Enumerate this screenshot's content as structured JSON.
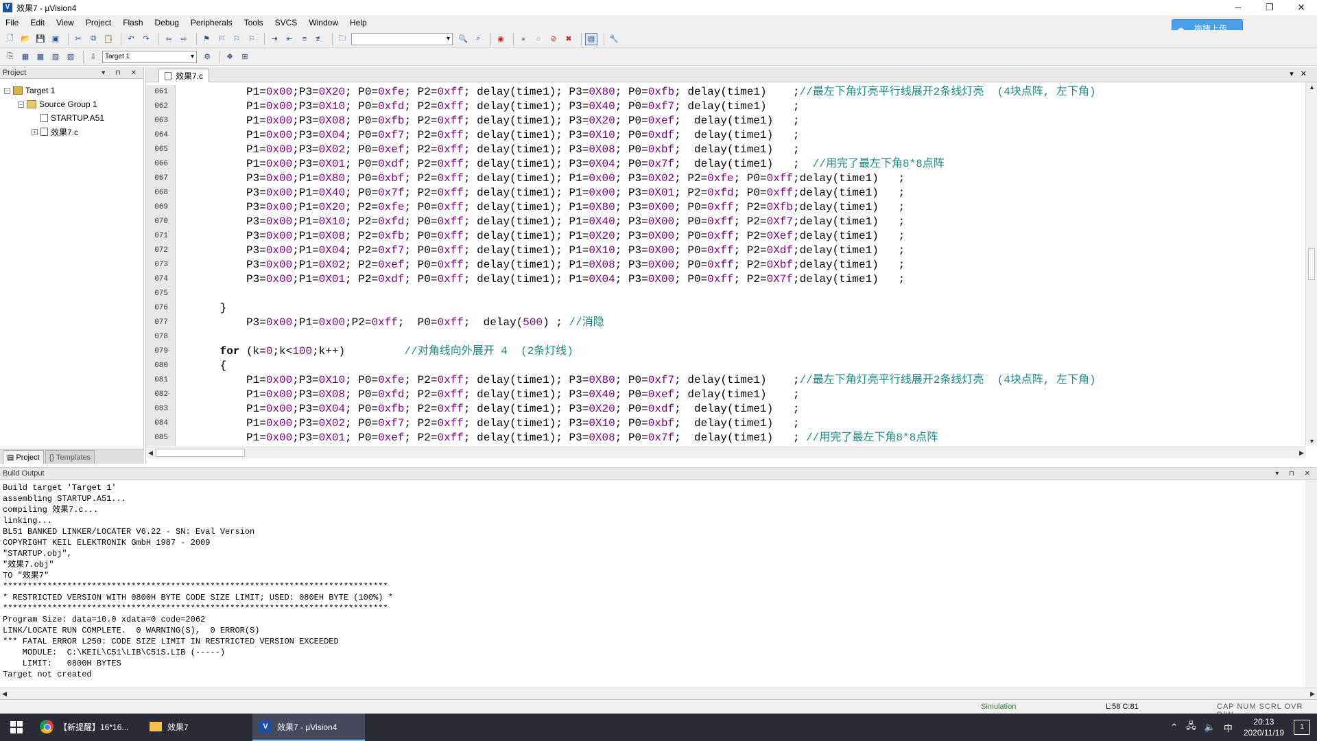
{
  "window": {
    "title": "效果7 - µVision4",
    "minimize": "─",
    "maximize": "❐",
    "close": "✕"
  },
  "menu": [
    "File",
    "Edit",
    "View",
    "Project",
    "Flash",
    "Debug",
    "Peripherals",
    "Tools",
    "SVCS",
    "Window",
    "Help"
  ],
  "toolbar": {
    "target_select": "Target 1",
    "upload_button": "拖拽上传"
  },
  "project_panel": {
    "title": "Project",
    "controls": "▾ ⊓ ✕",
    "tree": [
      {
        "label": "Target 1",
        "level": 0,
        "expander": "−",
        "icon": "target"
      },
      {
        "label": "Source Group 1",
        "level": 1,
        "expander": "−",
        "icon": "folder"
      },
      {
        "label": "STARTUP.A51",
        "level": 2,
        "expander": "",
        "icon": "file"
      },
      {
        "label": "效果7.c",
        "level": 2,
        "expander": "+",
        "icon": "file"
      }
    ],
    "tabs": [
      "Project",
      "Templates"
    ]
  },
  "editor": {
    "tab_label": "效果7.c",
    "line_numbers": [
      "061",
      "062",
      "063",
      "064",
      "065",
      "066",
      "067",
      "068",
      "069",
      "070",
      "071",
      "072",
      "073",
      "074",
      "075",
      "076",
      "077",
      "078",
      "079",
      "080",
      "081",
      "082",
      "083",
      "084",
      "085"
    ],
    "lines": [
      "          P1=0x00;P3=0X20; P0=0xfe; P2=0xff; delay(time1); P3=0X80; P0=0xfb; delay(time1)    ;//最左下角灯亮平行线展开2条线灯亮  (4块点阵, 左下角)",
      "          P1=0x00;P3=0X10; P0=0xfd; P2=0xff; delay(time1); P3=0X40; P0=0xf7; delay(time1)    ;",
      "          P1=0x00;P3=0X08; P0=0xfb; P2=0xff; delay(time1); P3=0X20; P0=0xef;  delay(time1)   ;",
      "          P1=0x00;P3=0X04; P0=0xf7; P2=0xff; delay(time1); P3=0X10; P0=0xdf;  delay(time1)   ;",
      "          P1=0x00;P3=0X02; P0=0xef; P2=0xff; delay(time1); P3=0X08; P0=0xbf;  delay(time1)   ;",
      "          P1=0x00;P3=0X01; P0=0xdf; P2=0xff; delay(time1); P3=0X04; P0=0x7f;  delay(time1)   ;  //用完了最左下角8*8点阵",
      "          P3=0x00;P1=0X80; P0=0xbf; P2=0xff; delay(time1); P1=0x00; P3=0X02; P2=0xfe; P0=0xff;delay(time1)   ;",
      "          P3=0x00;P1=0X40; P0=0x7f; P2=0xff; delay(time1); P1=0x00; P3=0X01; P2=0xfd; P0=0xff;delay(time1)   ;",
      "          P3=0x00;P1=0X20; P2=0xfe; P0=0xff; delay(time1); P1=0X80; P3=0X00; P0=0xff; P2=0Xfb;delay(time1)   ;",
      "          P3=0x00;P1=0X10; P2=0xfd; P0=0xff; delay(time1); P1=0X40; P3=0X00; P0=0xff; P2=0Xf7;delay(time1)   ;",
      "          P3=0x00;P1=0X08; P2=0xfb; P0=0xff; delay(time1); P1=0X20; P3=0X00; P0=0xff; P2=0Xef;delay(time1)   ;",
      "          P3=0x00;P1=0X04; P2=0xf7; P0=0xff; delay(time1); P1=0X10; P3=0X00; P0=0xff; P2=0Xdf;delay(time1)   ;",
      "          P3=0x00;P1=0X02; P2=0xef; P0=0xff; delay(time1); P1=0X08; P3=0X00; P0=0xff; P2=0Xbf;delay(time1)   ;",
      "          P3=0x00;P1=0X01; P2=0xdf; P0=0xff; delay(time1); P1=0X04; P3=0X00; P0=0xff; P2=0X7f;delay(time1)   ;",
      "",
      "      }",
      "          P3=0x00;P1=0x00;P2=0xff;  P0=0xff;  delay(500) ; //消隐",
      "",
      "      for (k=0;k<100;k++)         //对角线向外展开 4  (2条灯线)",
      "      {",
      "          P1=0x00;P3=0X10; P0=0xfe; P2=0xff; delay(time1); P3=0X80; P0=0xf7; delay(time1)    ;//最左下角灯亮平行线展开2条线灯亮  (4块点阵, 左下角)",
      "          P1=0x00;P3=0X08; P0=0xfd; P2=0xff; delay(time1); P3=0X40; P0=0xef; delay(time1)    ;",
      "          P1=0x00;P3=0X04; P0=0xfb; P2=0xff; delay(time1); P3=0X20; P0=0xdf;  delay(time1)   ;",
      "          P1=0x00;P3=0X02; P0=0xf7; P2=0xff; delay(time1); P3=0X10; P0=0xbf;  delay(time1)   ;",
      "          P1=0x00;P3=0X01; P0=0xef; P2=0xff; delay(time1); P3=0X08; P0=0x7f;  delay(time1)   ; //用完了最左下角8*8点阵"
    ]
  },
  "build_output": {
    "title": "Build Output",
    "lines": [
      "Build target 'Target 1'",
      "assembling STARTUP.A51...",
      "compiling 效果7.c...",
      "linking...",
      "BL51 BANKED LINKER/LOCATER V6.22 - SN: Eval Version",
      "COPYRIGHT KEIL ELEKTRONIK GmbH 1987 - 2009",
      "\"STARTUP.obj\",",
      "\"效果7.obj\"",
      "TO \"效果7\"",
      "******************************************************************************",
      "* RESTRICTED VERSION WITH 0800H BYTE CODE SIZE LIMIT; USED: 080EH BYTE (100%) *",
      "******************************************************************************",
      "Program Size: data=10.0 xdata=0 code=2062",
      "LINK/LOCATE RUN COMPLETE.  0 WARNING(S),  0 ERROR(S)",
      "*** FATAL ERROR L250: CODE SIZE LIMIT IN RESTRICTED VERSION EXCEEDED",
      "    MODULE:  C:\\KEIL\\C51\\LIB\\C51S.LIB (-----)",
      "    LIMIT:   0800H BYTES",
      "Target not created"
    ]
  },
  "status_bar": {
    "mode": "Simulation",
    "position": "L:58 C:81",
    "flags": "CAP  NUM  SCRL  OVR  R/W"
  },
  "taskbar": {
    "items": [
      {
        "label": "【新提醒】16*16...",
        "icon": "chrome-icon",
        "active": false
      },
      {
        "label": "效果7",
        "icon": "folder-icon",
        "active": false
      },
      {
        "label": "效果7 - µVision4",
        "icon": "uvision-icon",
        "active": true
      }
    ],
    "ime": "中",
    "time": "20:13",
    "date": "2020/11/19",
    "notifications": "1"
  }
}
